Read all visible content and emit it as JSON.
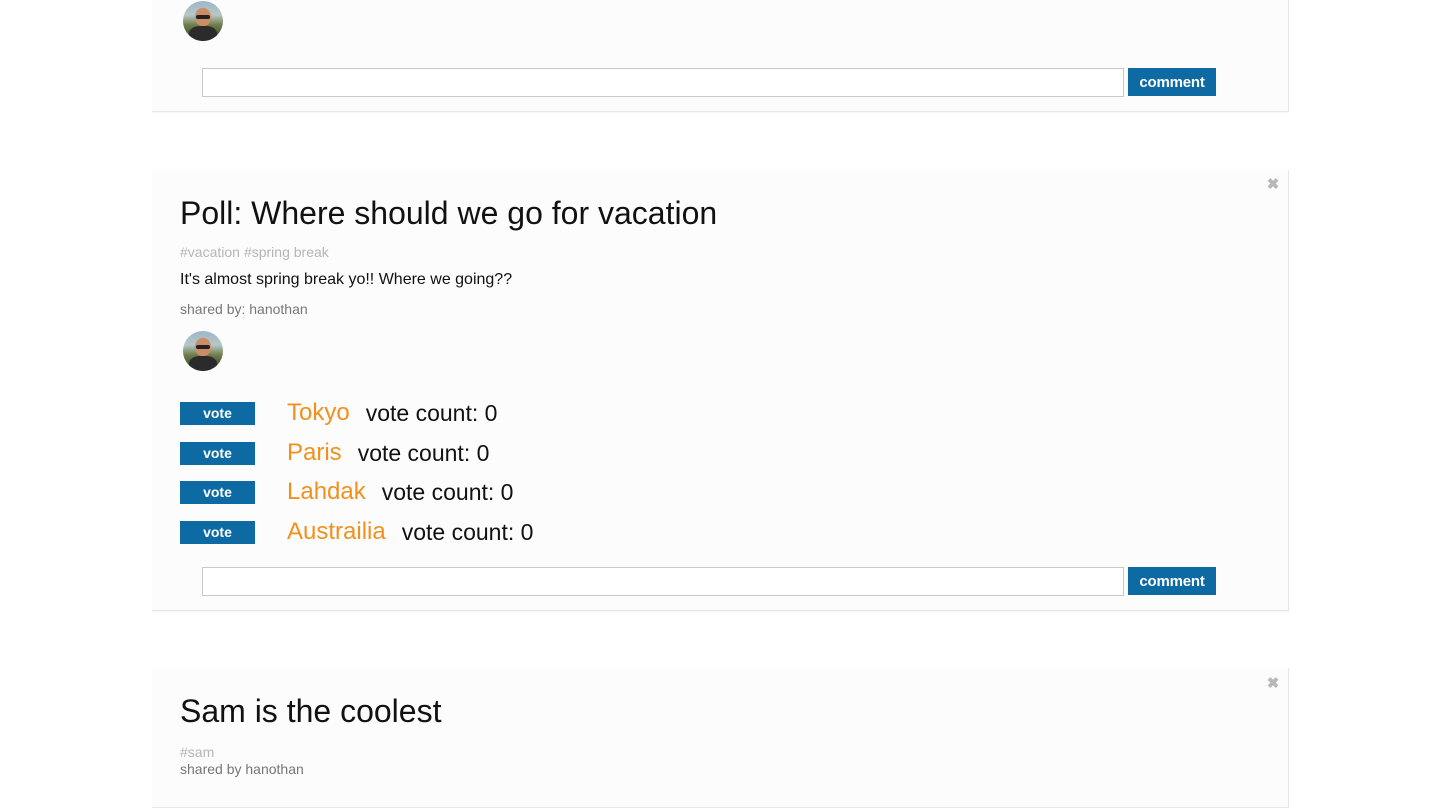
{
  "top_post": {
    "comment_placeholder": "",
    "comment_label": "comment"
  },
  "poll_post": {
    "close_glyph": "✖",
    "title": "Poll: Where should we go for vacation",
    "tags": [
      "#vacation",
      "#spring break"
    ],
    "body": "It's almost spring break yo!! Where we going??",
    "shared_by": "shared by: hanothan",
    "options": [
      {
        "vote_label": "vote",
        "name": "Tokyo",
        "count_text": "vote count: 0"
      },
      {
        "vote_label": "vote",
        "name": "Paris",
        "count_text": "vote count: 0"
      },
      {
        "vote_label": "vote",
        "name": "Lahdak",
        "count_text": "vote count: 0"
      },
      {
        "vote_label": "vote",
        "name": "Austrailia",
        "count_text": "vote count: 0"
      }
    ],
    "comment_placeholder": "",
    "comment_label": "comment"
  },
  "sam_post": {
    "close_glyph": "✖",
    "title": "Sam is the coolest",
    "tags": [
      "#sam"
    ],
    "shared_by": "shared by hanothan"
  },
  "colors": {
    "accent_blue": "#0d6aa3",
    "option_orange": "#f0911e",
    "tag_gray": "#b5b5b5"
  }
}
